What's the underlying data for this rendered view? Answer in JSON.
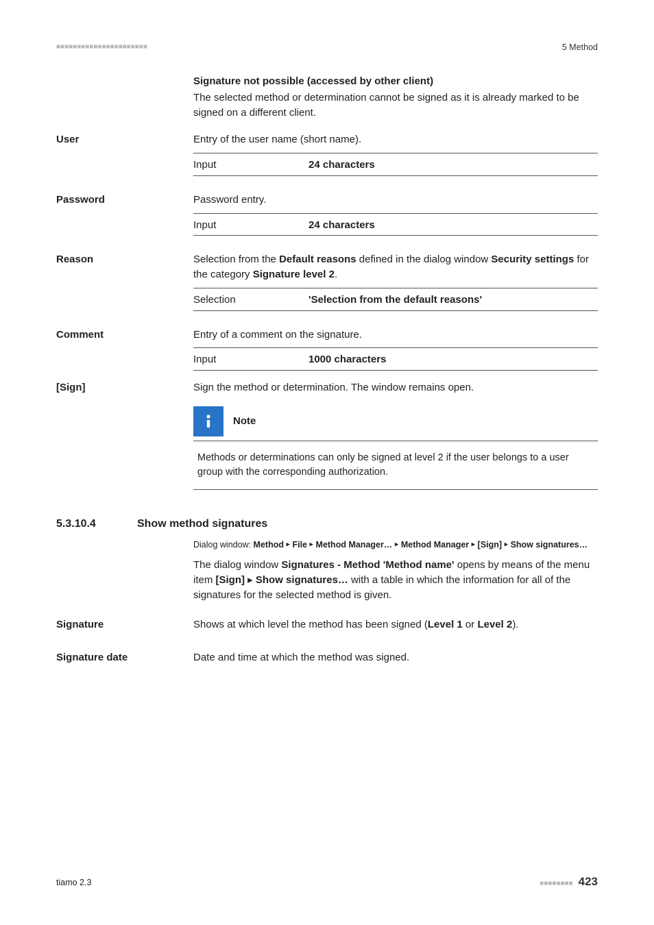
{
  "header": {
    "dashes": "■■■■■■■■■■■■■■■■■■■■■■",
    "chapter": "5 Method"
  },
  "sigNotPossible": {
    "title": "Signature not possible (accessed by other client)",
    "body": "The selected method or determination cannot be signed as it is already marked to be signed on a different client."
  },
  "user": {
    "label": "User",
    "desc": "Entry of the user name (short name).",
    "input_key": "Input",
    "input_val": "24 characters"
  },
  "password": {
    "label": "Password",
    "desc": "Password entry.",
    "input_key": "Input",
    "input_val": "24 characters"
  },
  "reason": {
    "label": "Reason",
    "desc_pre": "Selection from the ",
    "desc_bold1": "Default reasons",
    "desc_mid1": " defined in the dialog window ",
    "desc_bold2": "Security settings",
    "desc_mid2": " for the category ",
    "desc_bold3": "Signature level 2",
    "desc_end": ".",
    "sel_key": "Selection",
    "sel_val": "'Selection from the default reasons'"
  },
  "comment": {
    "label": "Comment",
    "desc": "Entry of a comment on the signature.",
    "input_key": "Input",
    "input_val": "1000 characters"
  },
  "sign": {
    "label": "[Sign]",
    "desc": "Sign the method or determination. The window remains open."
  },
  "note": {
    "title": "Note",
    "body": "Methods or determinations can only be signed at level 2 if the user belongs to a user group with the corresponding authorization."
  },
  "showSig": {
    "num": "5.3.10.4",
    "title": "Show method signatures",
    "path_pre": "Dialog window: ",
    "path_b1": "Method",
    "arrow": "▸",
    "path_b2": "File",
    "path_b3": "Method Manager…",
    "path_b4": "Method Manager",
    "path_b5": "[Sign]",
    "path_b6": "Show signatures…",
    "desc_pre": "The dialog window ",
    "desc_bold1": "Signatures - Method 'Method name'",
    "desc_mid1": " opens by means of the menu item ",
    "desc_bold2": "[Sign]",
    "desc_arrow": " ▸ ",
    "desc_bold3": "Show signatures…",
    "desc_end": " with a table in which the information for all of the signatures for the selected method is given."
  },
  "signature": {
    "label": "Signature",
    "desc_pre": "Shows at which level the method has been signed (",
    "desc_b1": "Level 1",
    "desc_mid": " or ",
    "desc_b2": "Level 2",
    "desc_end": ")."
  },
  "sigDate": {
    "label": "Signature date",
    "desc": "Date and time at which the method was signed."
  },
  "footer": {
    "left": "tiamo 2.3",
    "dashes": "■■■■■■■■",
    "page": "423"
  }
}
